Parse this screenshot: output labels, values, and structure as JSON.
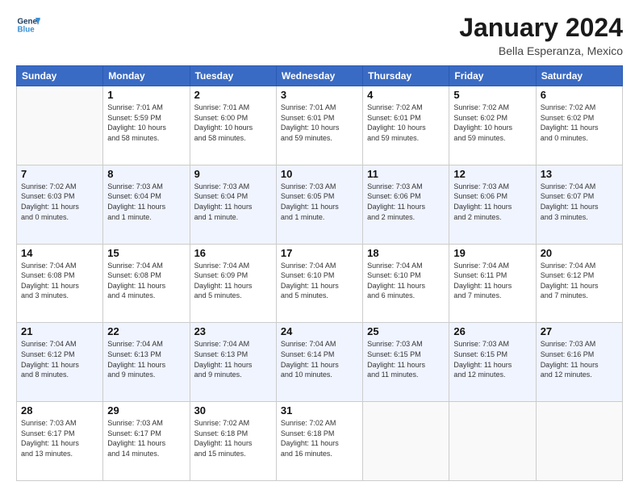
{
  "header": {
    "logo_line1": "General",
    "logo_line2": "Blue",
    "title": "January 2024",
    "location": "Bella Esperanza, Mexico"
  },
  "weekdays": [
    "Sunday",
    "Monday",
    "Tuesday",
    "Wednesday",
    "Thursday",
    "Friday",
    "Saturday"
  ],
  "weeks": [
    [
      {
        "day": "",
        "info": ""
      },
      {
        "day": "1",
        "info": "Sunrise: 7:01 AM\nSunset: 5:59 PM\nDaylight: 10 hours\nand 58 minutes."
      },
      {
        "day": "2",
        "info": "Sunrise: 7:01 AM\nSunset: 6:00 PM\nDaylight: 10 hours\nand 58 minutes."
      },
      {
        "day": "3",
        "info": "Sunrise: 7:01 AM\nSunset: 6:01 PM\nDaylight: 10 hours\nand 59 minutes."
      },
      {
        "day": "4",
        "info": "Sunrise: 7:02 AM\nSunset: 6:01 PM\nDaylight: 10 hours\nand 59 minutes."
      },
      {
        "day": "5",
        "info": "Sunrise: 7:02 AM\nSunset: 6:02 PM\nDaylight: 10 hours\nand 59 minutes."
      },
      {
        "day": "6",
        "info": "Sunrise: 7:02 AM\nSunset: 6:02 PM\nDaylight: 11 hours\nand 0 minutes."
      }
    ],
    [
      {
        "day": "7",
        "info": "Sunrise: 7:02 AM\nSunset: 6:03 PM\nDaylight: 11 hours\nand 0 minutes."
      },
      {
        "day": "8",
        "info": "Sunrise: 7:03 AM\nSunset: 6:04 PM\nDaylight: 11 hours\nand 1 minute."
      },
      {
        "day": "9",
        "info": "Sunrise: 7:03 AM\nSunset: 6:04 PM\nDaylight: 11 hours\nand 1 minute."
      },
      {
        "day": "10",
        "info": "Sunrise: 7:03 AM\nSunset: 6:05 PM\nDaylight: 11 hours\nand 1 minute."
      },
      {
        "day": "11",
        "info": "Sunrise: 7:03 AM\nSunset: 6:06 PM\nDaylight: 11 hours\nand 2 minutes."
      },
      {
        "day": "12",
        "info": "Sunrise: 7:03 AM\nSunset: 6:06 PM\nDaylight: 11 hours\nand 2 minutes."
      },
      {
        "day": "13",
        "info": "Sunrise: 7:04 AM\nSunset: 6:07 PM\nDaylight: 11 hours\nand 3 minutes."
      }
    ],
    [
      {
        "day": "14",
        "info": "Sunrise: 7:04 AM\nSunset: 6:08 PM\nDaylight: 11 hours\nand 3 minutes."
      },
      {
        "day": "15",
        "info": "Sunrise: 7:04 AM\nSunset: 6:08 PM\nDaylight: 11 hours\nand 4 minutes."
      },
      {
        "day": "16",
        "info": "Sunrise: 7:04 AM\nSunset: 6:09 PM\nDaylight: 11 hours\nand 5 minutes."
      },
      {
        "day": "17",
        "info": "Sunrise: 7:04 AM\nSunset: 6:10 PM\nDaylight: 11 hours\nand 5 minutes."
      },
      {
        "day": "18",
        "info": "Sunrise: 7:04 AM\nSunset: 6:10 PM\nDaylight: 11 hours\nand 6 minutes."
      },
      {
        "day": "19",
        "info": "Sunrise: 7:04 AM\nSunset: 6:11 PM\nDaylight: 11 hours\nand 7 minutes."
      },
      {
        "day": "20",
        "info": "Sunrise: 7:04 AM\nSunset: 6:12 PM\nDaylight: 11 hours\nand 7 minutes."
      }
    ],
    [
      {
        "day": "21",
        "info": "Sunrise: 7:04 AM\nSunset: 6:12 PM\nDaylight: 11 hours\nand 8 minutes."
      },
      {
        "day": "22",
        "info": "Sunrise: 7:04 AM\nSunset: 6:13 PM\nDaylight: 11 hours\nand 9 minutes."
      },
      {
        "day": "23",
        "info": "Sunrise: 7:04 AM\nSunset: 6:13 PM\nDaylight: 11 hours\nand 9 minutes."
      },
      {
        "day": "24",
        "info": "Sunrise: 7:04 AM\nSunset: 6:14 PM\nDaylight: 11 hours\nand 10 minutes."
      },
      {
        "day": "25",
        "info": "Sunrise: 7:03 AM\nSunset: 6:15 PM\nDaylight: 11 hours\nand 11 minutes."
      },
      {
        "day": "26",
        "info": "Sunrise: 7:03 AM\nSunset: 6:15 PM\nDaylight: 11 hours\nand 12 minutes."
      },
      {
        "day": "27",
        "info": "Sunrise: 7:03 AM\nSunset: 6:16 PM\nDaylight: 11 hours\nand 12 minutes."
      }
    ],
    [
      {
        "day": "28",
        "info": "Sunrise: 7:03 AM\nSunset: 6:17 PM\nDaylight: 11 hours\nand 13 minutes."
      },
      {
        "day": "29",
        "info": "Sunrise: 7:03 AM\nSunset: 6:17 PM\nDaylight: 11 hours\nand 14 minutes."
      },
      {
        "day": "30",
        "info": "Sunrise: 7:02 AM\nSunset: 6:18 PM\nDaylight: 11 hours\nand 15 minutes."
      },
      {
        "day": "31",
        "info": "Sunrise: 7:02 AM\nSunset: 6:18 PM\nDaylight: 11 hours\nand 16 minutes."
      },
      {
        "day": "",
        "info": ""
      },
      {
        "day": "",
        "info": ""
      },
      {
        "day": "",
        "info": ""
      }
    ]
  ]
}
